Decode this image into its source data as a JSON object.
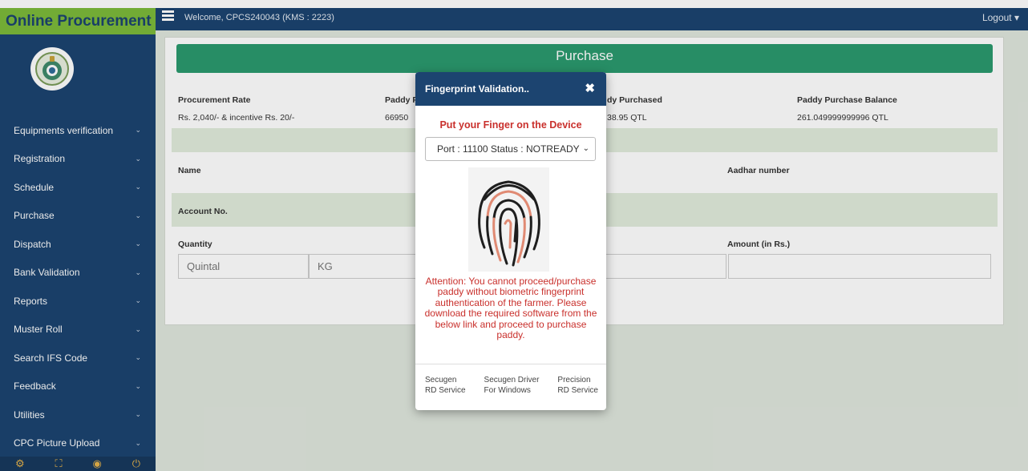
{
  "app": {
    "brand": "Online Procurement"
  },
  "header": {
    "welcome": "Welcome, CPCS240043 (KMS : 2223)",
    "logout": "Logout ▾"
  },
  "sidebar": {
    "items": [
      {
        "label": "Equipments verification"
      },
      {
        "label": "Registration"
      },
      {
        "label": "Schedule"
      },
      {
        "label": "Purchase"
      },
      {
        "label": "Dispatch"
      },
      {
        "label": "Bank Validation"
      },
      {
        "label": "Reports"
      },
      {
        "label": "Muster Roll"
      },
      {
        "label": "Search IFS Code"
      },
      {
        "label": "Feedback"
      },
      {
        "label": "Utilities"
      },
      {
        "label": "CPC Picture Upload"
      }
    ]
  },
  "main": {
    "title": "Purchase",
    "procurement_rate_label": "Procurement Rate",
    "procurement_rate_value": "Rs. 2,040/- & incentive Rs. 20/-",
    "paddy_p_label": "Paddy P",
    "paddy_p_value": "66950",
    "paddy_purchased_label": "dy Purchased",
    "paddy_purchased_value": "38.95 QTL",
    "balance_label": "Paddy Purchase Balance",
    "balance_value": "261.049999999996 QTL",
    "name_label": "Name",
    "aadhar_label": "Aadhar number",
    "account_label": "Account No.",
    "quantity_label": "Quantity",
    "amount_label": "Amount (in Rs.)",
    "quintal_placeholder": "Quintal",
    "kg_placeholder": "KG"
  },
  "modal": {
    "title": "Fingerprint Validation..",
    "close": "✖",
    "prompt": "Put your Finger on the Device",
    "port_status": "Port : 11100 Status : NOTREADY",
    "attention": "Attention: You cannot proceed/purchase paddy without biometric fingerprint authentication of the farmer. Please download the required software from the below link and proceed to purchase paddy.",
    "links": [
      {
        "line1": "Secugen",
        "line2": "RD Service"
      },
      {
        "line1": "Secugen Driver",
        "line2": "For Windows"
      },
      {
        "line1": "Precision",
        "line2": "RD Service"
      }
    ]
  },
  "colors": {
    "navy": "#1c4470",
    "brand_green": "#7cba3a",
    "purchase_green": "#2b9a6e",
    "alert_red": "#c9302c"
  }
}
